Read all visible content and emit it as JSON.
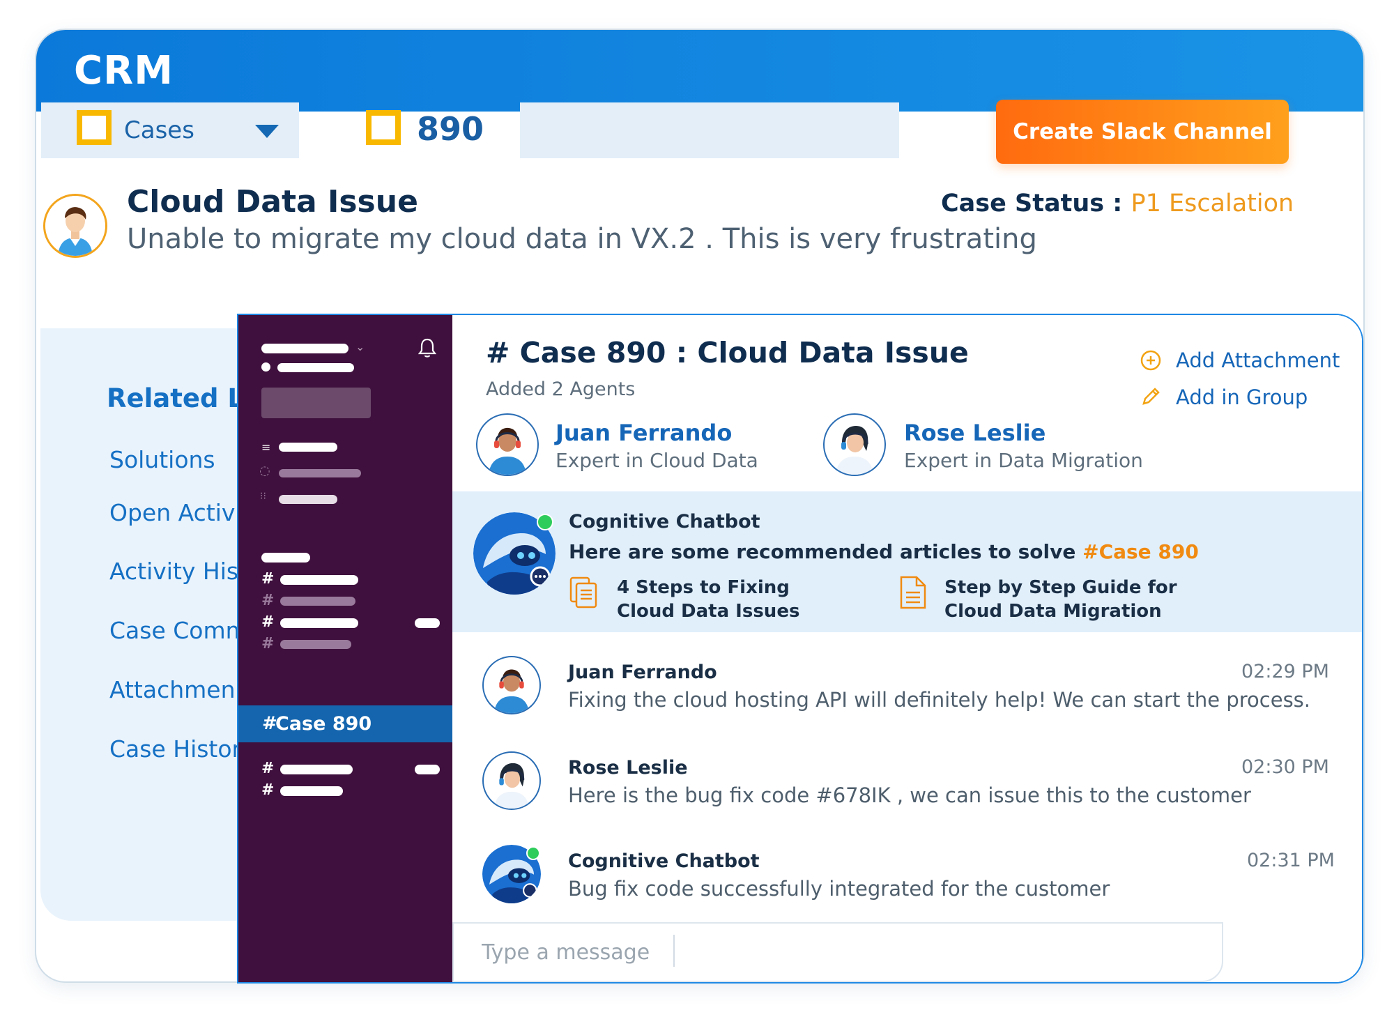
{
  "crm": {
    "title": "CRM",
    "module_label": "Cases",
    "case_number": "890",
    "search_placeholder": "",
    "create_channel_label": "Create Slack Channel",
    "case_title": "Cloud Data Issue",
    "case_description": "Unable to migrate my cloud data in VX.2 . This is very frustrating",
    "case_status_label": "Case Status : ",
    "case_status_value": "P1 Escalation",
    "related_heading": "Related Li",
    "related_items": [
      "Solutions",
      "Open Activ",
      "Activity His",
      "Case Comm",
      "Attachmen",
      "Case Histor"
    ]
  },
  "slack": {
    "active_channel": "Case 890",
    "channel_title": "# Case 890 : Cloud Data Issue",
    "channel_subtitle": "Added 2 Agents",
    "actions": {
      "add_attachment": "Add Attachment",
      "add_in_group": "Add in Group"
    },
    "agents": [
      {
        "name": "Juan Ferrando",
        "role": "Expert in Cloud Data"
      },
      {
        "name": "Rose Leslie",
        "role": "Expert in Data Migration"
      }
    ],
    "bot": {
      "name": "Cognitive Chatbot",
      "message_prefix": "Here are some recommended articles to solve ",
      "message_tag": "#Case 890",
      "articles": [
        {
          "line1": "4 Steps to Fixing",
          "line2": "Cloud Data Issues"
        },
        {
          "line1": "Step by Step Guide for",
          "line2": "Cloud Data Migration"
        }
      ]
    },
    "messages": [
      {
        "name": "Juan Ferrando",
        "time": "02:29 PM",
        "text": "Fixing the cloud hosting API will definitely help! We can start the process."
      },
      {
        "name": "Rose Leslie",
        "time": "02:30 PM",
        "text": "Here is the bug fix code #678IK , we can issue this to the customer"
      },
      {
        "name": "Cognitive Chatbot",
        "time": "02:31 PM",
        "text": "Bug fix code successfully integrated for the customer"
      }
    ],
    "composer_placeholder": "Type a message",
    "colors": {
      "sidebar": "#3f103d",
      "active_channel": "#1465ae",
      "accent_orange": "#f08a10",
      "crm_blue": "#0b79d9"
    }
  }
}
